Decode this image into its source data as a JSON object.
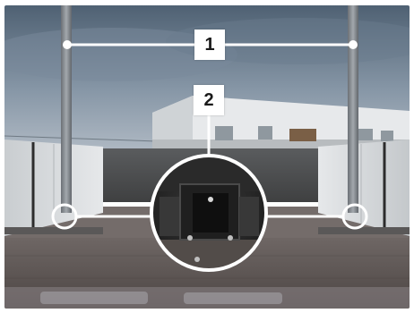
{
  "callouts": [
    {
      "label": "1"
    },
    {
      "label": "2"
    }
  ],
  "colors": {
    "sky": "#5d6e80",
    "sky_light": "#a9b5c1",
    "tarmac": "#4a4b4b",
    "trailer_floor": "#6a6462",
    "wall_panel": "#d8dbdd",
    "post": "#8a8f93",
    "annotation": "#ffffff"
  }
}
